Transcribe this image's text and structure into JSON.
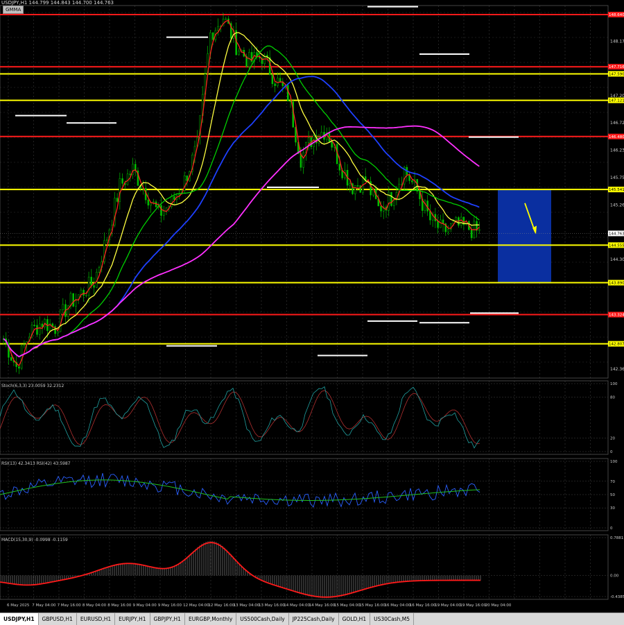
{
  "header": {
    "symbol_info": "USDJPY,H1  144.799 144.843 144.700 144.763",
    "indicator_badge": "GMMA"
  },
  "colors": {
    "background": "#000000",
    "candle": "#00c000",
    "red_level": "#ff1a1a",
    "yellow_level": "#ffff00",
    "ema_fast": "#ff2020",
    "ema_mid": "#ffff40",
    "ema_green": "#00d000",
    "ema_blue": "#1e40ff",
    "ema_magenta": "#ff30ff",
    "target_box": "#0a2fa0",
    "arrow": "#ffff00"
  },
  "tabs": [
    {
      "label": "USDJPY,H1",
      "active": true
    },
    {
      "label": "GBPUSD,H1",
      "active": false
    },
    {
      "label": "EURUSD,H1",
      "active": false
    },
    {
      "label": "EURJPY,H1",
      "active": false
    },
    {
      "label": "GBPJPY,H1",
      "active": false
    },
    {
      "label": "EURGBP,Monthly",
      "active": false
    },
    {
      "label": "US500Cash,Daily",
      "active": false
    },
    {
      "label": "JP225Cash,Daily",
      "active": false
    },
    {
      "label": "GOLD,H1",
      "active": false
    },
    {
      "label": "US30Cash,M5",
      "active": false
    }
  ],
  "chart_data": [
    {
      "type": "line",
      "panel": "price",
      "ylim": [
        142.2,
        148.8
      ],
      "price_ticks": [
        "148.170",
        "147.205",
        "146.720",
        "146.235",
        "145.750",
        "145.265",
        "144.300",
        "142.360"
      ],
      "levels": [
        {
          "price": 148.64,
          "label": "148.640",
          "color": "red"
        },
        {
          "price": 147.716,
          "label": "147.716",
          "color": "red"
        },
        {
          "price": 147.59,
          "label": "147.590",
          "color": "yellow"
        },
        {
          "price": 147.121,
          "label": "147.121",
          "color": "yellow"
        },
        {
          "price": 146.48,
          "label": "146.480",
          "color": "red"
        },
        {
          "price": 145.541,
          "label": "145.541",
          "color": "yellow"
        },
        {
          "price": 144.555,
          "label": "144.555",
          "color": "yellow"
        },
        {
          "price": 143.89,
          "label": "143.890",
          "color": "yellow"
        },
        {
          "price": 143.324,
          "label": "143.324",
          "color": "red"
        },
        {
          "price": 142.807,
          "label": "142.807",
          "color": "yellow"
        }
      ],
      "current_price": {
        "price": 144.763,
        "label": "144.763"
      },
      "x_ticks": [
        "6 May 2025",
        "7 May 04:00",
        "7 May 16:00",
        "8 May 04:00",
        "8 May 16:00",
        "9 May 04:00",
        "9 May 16:00",
        "12 May 04:00",
        "12 May 16:00",
        "13 May 04:00",
        "13 May 16:00",
        "14 May 04:00",
        "14 May 16:00",
        "15 May 04:00",
        "15 May 16:00",
        "16 May 04:00",
        "16 May 16:00",
        "19 May 04:00",
        "19 May 16:00",
        "20 May 04:00"
      ],
      "close_path": [
        142.9,
        142.4,
        143.0,
        143.2,
        143.1,
        143.5,
        143.7,
        143.9,
        144.7,
        145.6,
        145.9,
        145.5,
        145.1,
        145.3,
        145.7,
        146.3,
        148.3,
        148.6,
        148.1,
        147.8,
        147.9,
        147.5,
        147.2,
        146.1,
        146.5,
        146.6,
        146.0,
        145.6,
        145.7,
        145.2,
        145.4,
        145.9,
        145.5,
        145.0,
        144.8,
        144.9,
        144.85,
        144.76
      ]
    },
    {
      "type": "line",
      "panel": "oscillator",
      "title": "Stoch(6,3,3) 23.0059 32.2312",
      "ylim": [
        0,
        100
      ],
      "y_ticks": [
        "100",
        "80",
        "20",
        "0"
      ]
    },
    {
      "type": "line",
      "panel": "oscillator",
      "title": "RSI(13) 42.3413  RSI(42) 43.5987",
      "ylim": [
        0,
        100
      ],
      "y_ticks": [
        "100",
        "70",
        "50",
        "30",
        "0"
      ]
    },
    {
      "type": "line",
      "panel": "oscillator",
      "title": "MACD(15,30,9) -0.0998 -0.1159",
      "ylim": [
        -0.4385,
        0.7881
      ],
      "y_ticks": [
        "0.7881",
        "0.00",
        "-0.4385"
      ]
    }
  ]
}
